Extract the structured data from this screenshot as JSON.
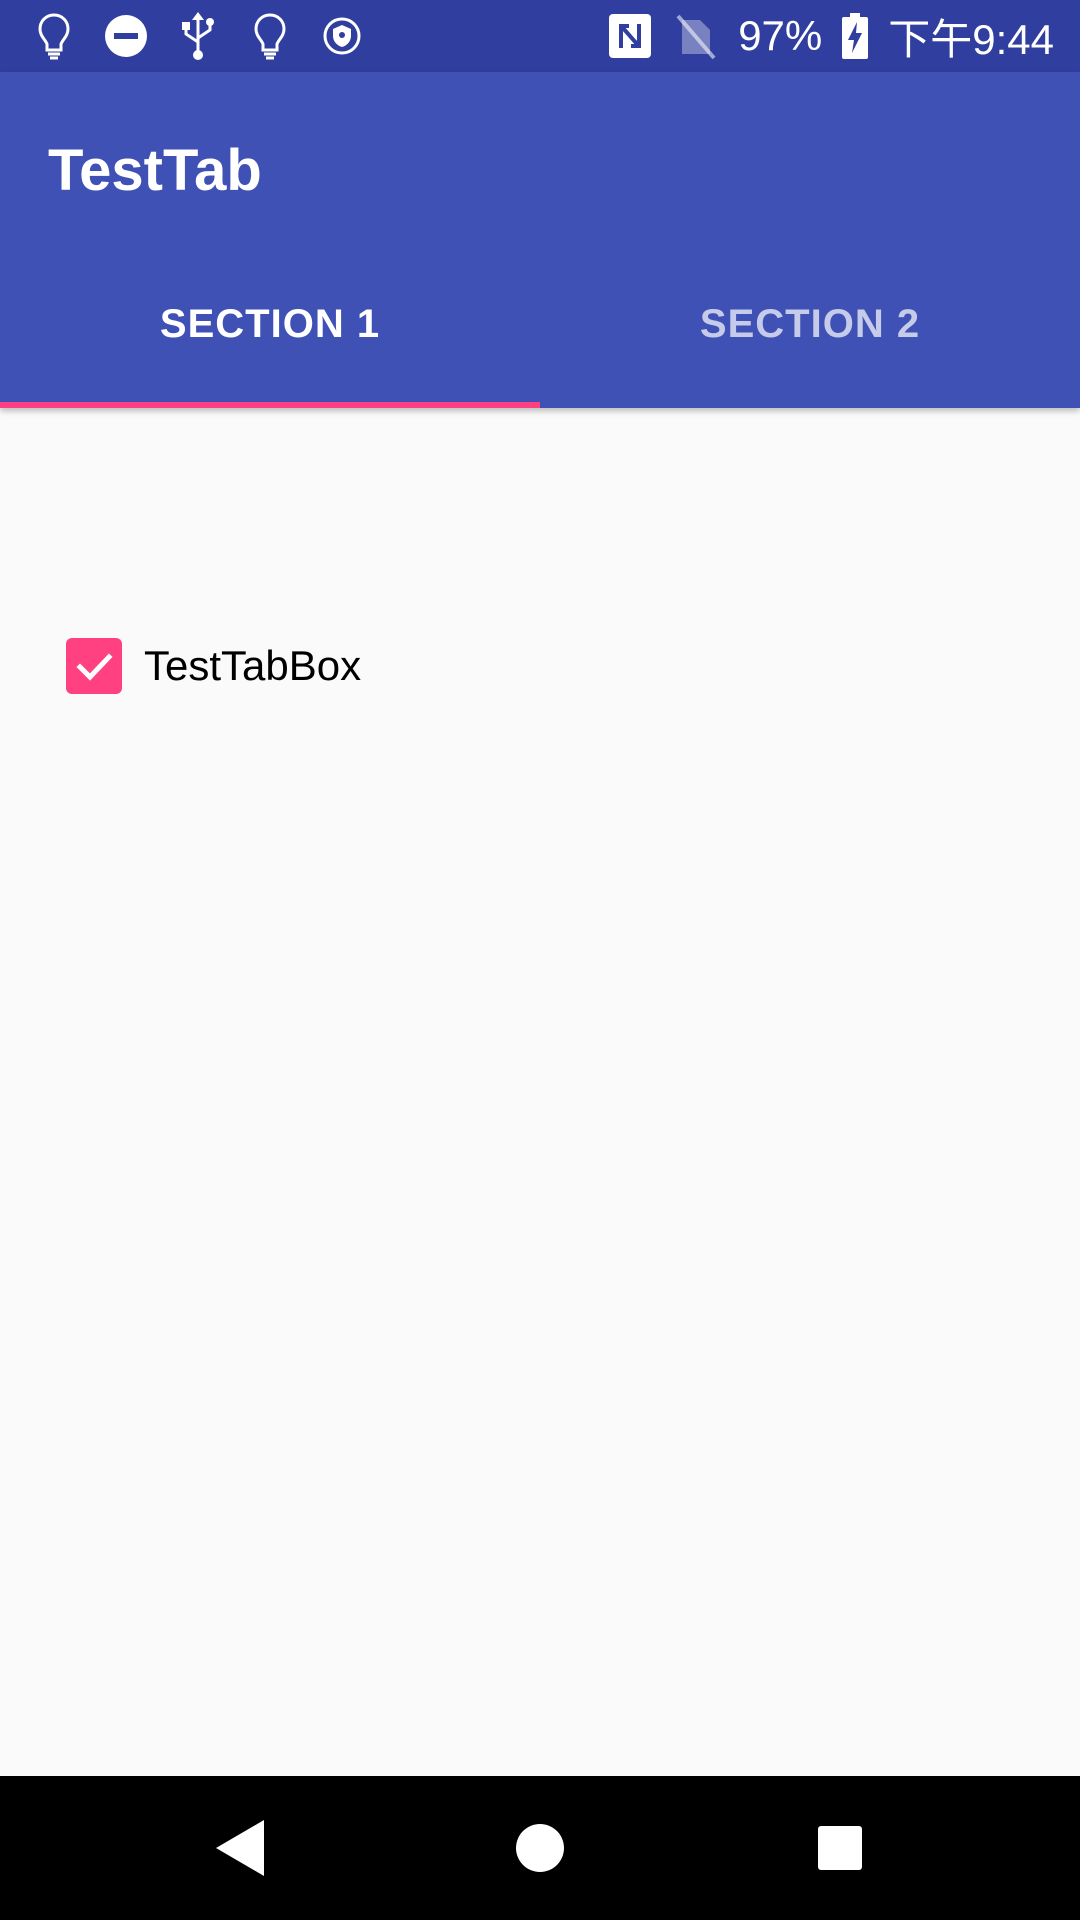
{
  "status_bar": {
    "battery_percent": "97%",
    "time": "下午9:44",
    "left_icons": [
      "lightbulb-icon",
      "do-not-disturb-icon",
      "usb-icon",
      "lightbulb-icon",
      "vpn-shield-icon"
    ],
    "right_icons": [
      "nfc-icon",
      "no-sim-icon",
      "battery-charging-icon"
    ]
  },
  "app_bar": {
    "title": "TestTab",
    "background": "#3f51b5",
    "status_background": "#303f9f"
  },
  "tabs": [
    {
      "label": "SECTION 1",
      "selected": true
    },
    {
      "label": "SECTION 2",
      "selected": false
    }
  ],
  "accent_color": "#ff4081",
  "content": {
    "checkbox": {
      "label": "TestTabBox",
      "checked": true
    }
  },
  "nav_bar": {
    "buttons": [
      "back-icon",
      "home-icon",
      "recents-icon"
    ]
  }
}
